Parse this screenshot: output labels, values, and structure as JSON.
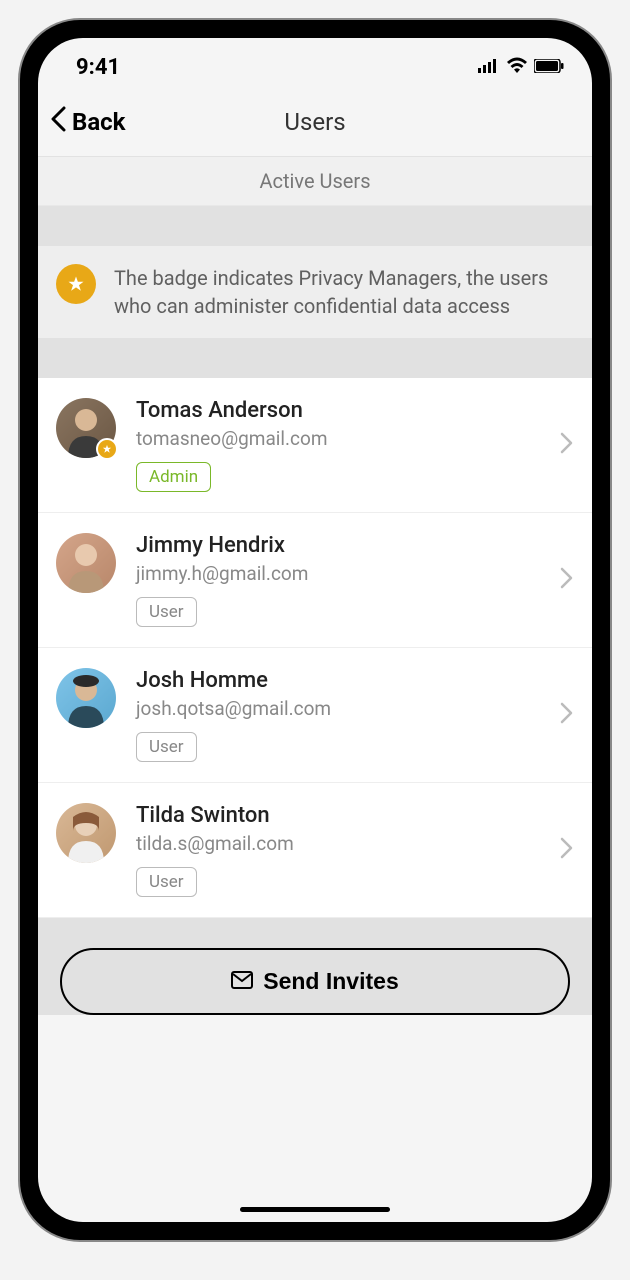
{
  "status": {
    "time": "9:41"
  },
  "nav": {
    "back_label": "Back",
    "title": "Users"
  },
  "section": {
    "header": "Active Users"
  },
  "banner": {
    "text": "The badge indicates Privacy Managers, the users who can administer confidential data access"
  },
  "users": [
    {
      "name": "Tomas Anderson",
      "email": "tomasneo@gmail.com",
      "role": "Admin",
      "is_admin": true,
      "has_badge": true
    },
    {
      "name": "Jimmy Hendrix",
      "email": "jimmy.h@gmail.com",
      "role": "User",
      "is_admin": false,
      "has_badge": false
    },
    {
      "name": "Josh Homme",
      "email": "josh.qotsa@gmail.com",
      "role": "User",
      "is_admin": false,
      "has_badge": false
    },
    {
      "name": "Tilda Swinton",
      "email": "tilda.s@gmail.com",
      "role": "User",
      "is_admin": false,
      "has_badge": false
    }
  ],
  "footer": {
    "send_label": "Send Invites"
  }
}
